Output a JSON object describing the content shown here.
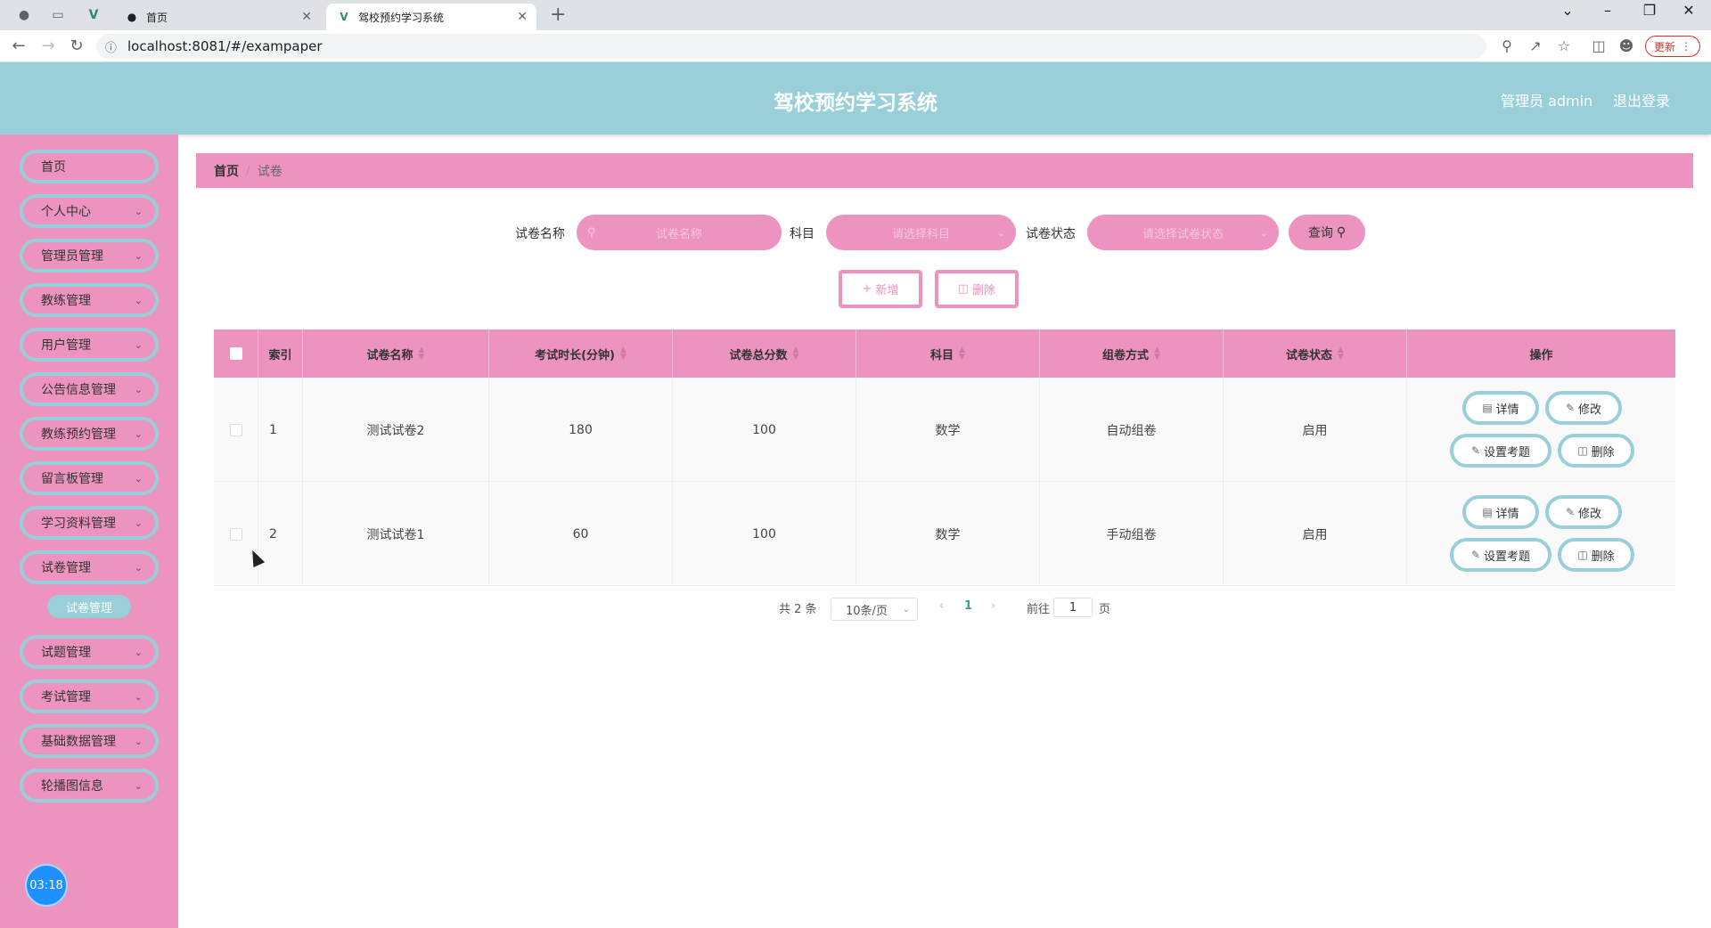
{
  "browser": {
    "tabs": [
      {
        "title": "首页",
        "active": false
      },
      {
        "title": "驾校预约学习系统",
        "active": true
      }
    ],
    "url": "localhost:8081/#/exampaper",
    "update_label": "更新"
  },
  "header": {
    "title": "驾校预约学习系统",
    "user": "管理员 admin",
    "logout": "退出登录"
  },
  "sidebar": {
    "items": [
      {
        "label": "首页",
        "has_children": false
      },
      {
        "label": "个人中心",
        "has_children": true
      },
      {
        "label": "管理员管理",
        "has_children": true
      },
      {
        "label": "教练管理",
        "has_children": true
      },
      {
        "label": "用户管理",
        "has_children": true
      },
      {
        "label": "公告信息管理",
        "has_children": true
      },
      {
        "label": "教练预约管理",
        "has_children": true
      },
      {
        "label": "留言板管理",
        "has_children": true
      },
      {
        "label": "学习资料管理",
        "has_children": true
      },
      {
        "label": "试卷管理",
        "has_children": true
      },
      {
        "label": "试题管理",
        "has_children": true
      },
      {
        "label": "考试管理",
        "has_children": true
      },
      {
        "label": "基础数据管理",
        "has_children": true
      },
      {
        "label": "轮播图信息",
        "has_children": true
      }
    ],
    "active_sub": "试卷管理",
    "clock": "03:18"
  },
  "breadcrumb": {
    "home": "首页",
    "separator": "/",
    "current": "试卷"
  },
  "search": {
    "name_label": "试卷名称",
    "name_placeholder": "试卷名称",
    "subject_label": "科目",
    "subject_placeholder": "请选择科目",
    "status_label": "试卷状态",
    "status_placeholder": "请选择试卷状态",
    "query_label": "查询"
  },
  "actions": {
    "add_label": "新增",
    "delete_label": "删除"
  },
  "table": {
    "headers": [
      "索引",
      "试卷名称",
      "考试时长(分钟)",
      "试卷总分数",
      "科目",
      "组卷方式",
      "试卷状态",
      "操作"
    ],
    "rows": [
      {
        "index": "1",
        "name": "测试试卷2",
        "duration": "180",
        "score": "100",
        "subject": "数学",
        "method": "自动组卷",
        "status": "启用"
      },
      {
        "index": "2",
        "name": "测试试卷1",
        "duration": "60",
        "score": "100",
        "subject": "数学",
        "method": "手动组卷",
        "status": "启用"
      }
    ],
    "op_labels": {
      "detail": "详情",
      "edit": "修改",
      "set_questions": "设置考题",
      "delete": "删除"
    }
  },
  "pagination": {
    "total": "共 2 条",
    "page_size": "10条/页",
    "current_page": "1",
    "goto_prefix": "前往",
    "goto_value": "1",
    "goto_suffix": "页"
  },
  "colors": {
    "header": "#98cfd9",
    "sidebar": "#ec94bf",
    "accent_pink": "#ec94bf",
    "accent_teal": "#98cfd9"
  }
}
